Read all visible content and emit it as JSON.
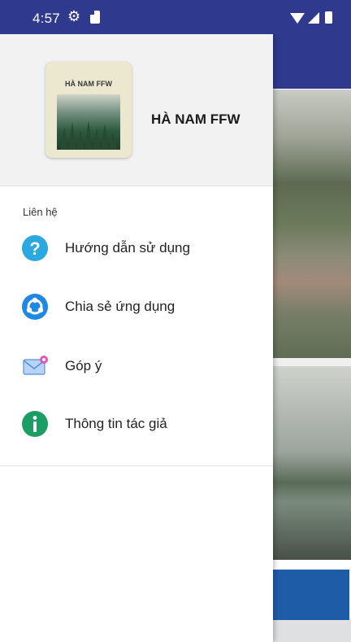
{
  "status_bar": {
    "time": "4:57"
  },
  "drawer": {
    "logo_text": "HÀ NAM FFW",
    "app_name": "HÀ NAM FFW",
    "section_label": "Liên hệ",
    "items": [
      {
        "label": "Hướng dẫn sử dụng",
        "icon": "question-icon"
      },
      {
        "label": "Chia sẻ ứng dụng",
        "icon": "share-icon"
      },
      {
        "label": "Góp ý",
        "icon": "mail-icon"
      },
      {
        "label": "Thông tin tác giả",
        "icon": "info-icon"
      }
    ]
  },
  "colors": {
    "primary": "#2f3a8e",
    "button": "#1f5ca8"
  }
}
